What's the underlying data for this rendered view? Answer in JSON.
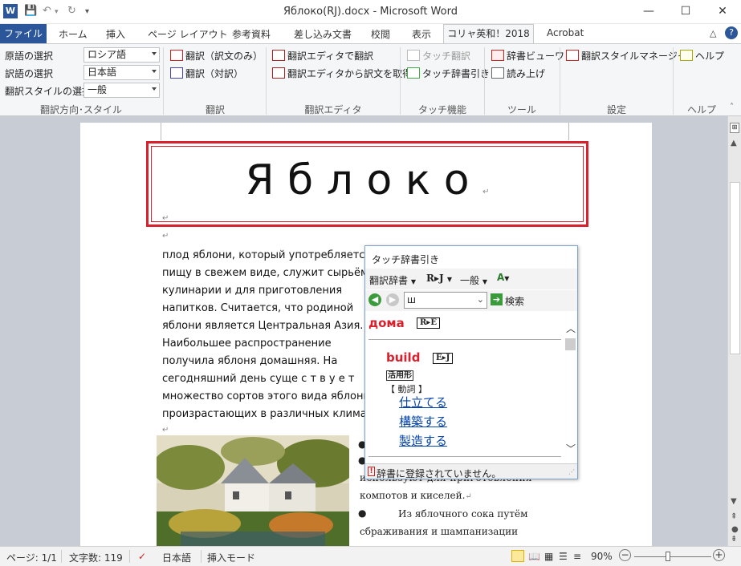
{
  "window": {
    "title": "Яблоко(RJ).docx - Microsoft Word",
    "minimize": "—",
    "maximize": "☐",
    "close": "✕"
  },
  "tabs": {
    "file": "ファイル",
    "items": [
      "ホーム",
      "挿入",
      "ページ レイアウト",
      "参考資料",
      "差し込み文書",
      "校閲",
      "表示"
    ],
    "active": "コリャ英和！2018",
    "acrobat": "Acrobat"
  },
  "ribbon": {
    "source_lang_label": "原語の選択",
    "source_lang_value": "ロシア語",
    "target_lang_label": "訳語の選択",
    "target_lang_value": "日本語",
    "style_label": "翻訳スタイルの選択",
    "style_value": "一般",
    "group_direction": "翻訳方向･スタイル",
    "translate_only": "翻訳（訳文のみ）",
    "translate_pair": "翻訳（対訳）",
    "group_translate": "翻訳",
    "editor_translate": "翻訳エディタで翻訳",
    "editor_get": "翻訳エディタから訳文を取得",
    "group_editor": "翻訳エディタ",
    "touch_translate": "タッチ翻訳",
    "touch_dict": "タッチ辞書引き",
    "group_touch": "タッチ機能",
    "dict_viewer": "辞書ビューワ",
    "read_aloud": "読み上げ",
    "group_tools": "ツール",
    "style_manager": "翻訳スタイルマネージャ",
    "group_settings": "設定",
    "help": "ヘルプ",
    "group_help": "ヘルプ"
  },
  "document": {
    "title": "Я б л о к о",
    "para_lines": [
      "плод яблони, который употребляется в",
      "пищу в свежем виде, служит сырьём в",
      "кулинарии и для приготовления",
      "напитков. Считается, что родиной",
      "яблони является Центральная Азия.",
      "Наибольшее распространение",
      "получила яблоня домашняя. На",
      "сегодняшний день суще с т в у е т",
      "множество сортов этого вида яблони,",
      "произрастающих в различных климатич"
    ],
    "bullets": [
      "используют для приготовления",
      "компотов и киселей.",
      "Из яблочного сока путём",
      "сбраживания и шампанизации"
    ]
  },
  "popup": {
    "title": "タッチ辞書引き",
    "dict_menu": "翻訳辞書",
    "direction_menu": "R▸J",
    "style_menu": "一般",
    "search_value": "ш",
    "search_button": "検索",
    "headword": "дома",
    "headword_badge": "R▸E",
    "sub_headword": "build",
    "sub_badge": "E▸J",
    "inflection": "活用形",
    "pos": "【 動詞 】",
    "senses": [
      "仕立てる",
      "構築する",
      "製造する"
    ],
    "status": "辞書に登録されていません。"
  },
  "status": {
    "page": "ページ: 1/1",
    "words": "文字数: 119",
    "language": "日本語",
    "mode": "挿入モード",
    "zoom": "90%"
  },
  "colors": {
    "accent": "#2b579a",
    "title_border": "#d9202c",
    "headword": "#d9202c",
    "link": "#0645ad"
  }
}
